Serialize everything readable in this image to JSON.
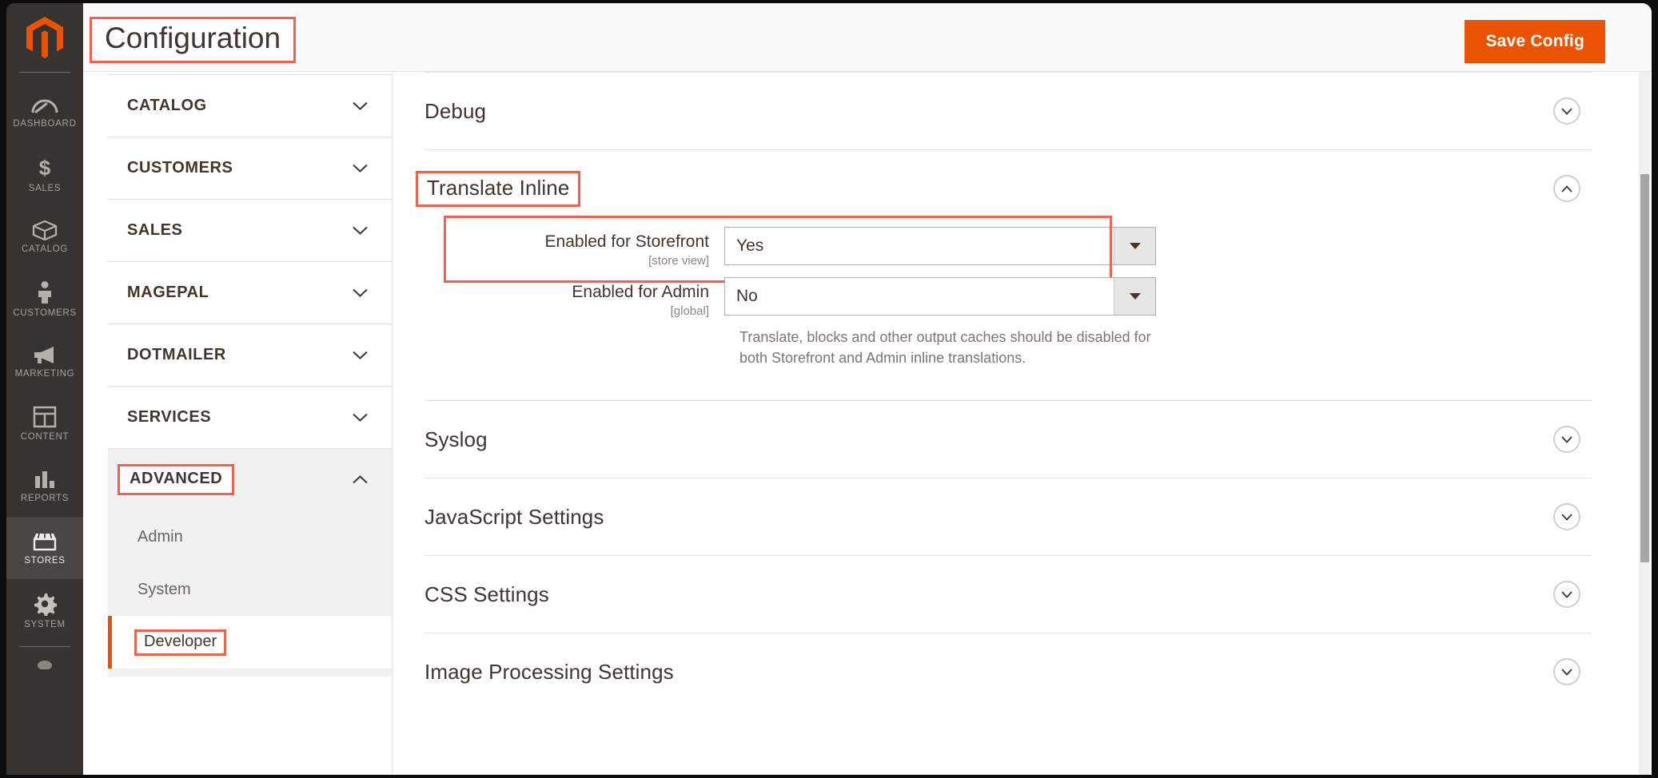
{
  "admin_sidebar": {
    "logo_name": "magento-logo",
    "items": [
      {
        "label": "DASHBOARD",
        "icon": "dashboard-gauge-icon",
        "active": false
      },
      {
        "label": "SALES",
        "icon": "dollar-sign-icon",
        "active": false
      },
      {
        "label": "CATALOG",
        "icon": "box-icon",
        "active": false
      },
      {
        "label": "CUSTOMERS",
        "icon": "person-icon",
        "active": false
      },
      {
        "label": "MARKETING",
        "icon": "megaphone-icon",
        "active": false
      },
      {
        "label": "CONTENT",
        "icon": "layout-page-icon",
        "active": false
      },
      {
        "label": "REPORTS",
        "icon": "bar-chart-icon",
        "active": false
      },
      {
        "label": "STORES",
        "icon": "store-awning-icon",
        "active": true
      },
      {
        "label": "SYSTEM",
        "icon": "gear-icon",
        "active": false
      }
    ]
  },
  "header": {
    "title": "Configuration",
    "save_label": "Save Config"
  },
  "config_nav": {
    "groups": [
      {
        "label": "CATALOG",
        "expanded": false
      },
      {
        "label": "CUSTOMERS",
        "expanded": false
      },
      {
        "label": "SALES",
        "expanded": false
      },
      {
        "label": "MAGEPAL",
        "expanded": false
      },
      {
        "label": "DOTMAILER",
        "expanded": false
      },
      {
        "label": "SERVICES",
        "expanded": false
      },
      {
        "label": "ADVANCED",
        "expanded": true
      }
    ],
    "advanced_children": [
      {
        "label": "Admin",
        "active": false
      },
      {
        "label": "System",
        "active": false
      },
      {
        "label": "Developer",
        "active": true
      }
    ]
  },
  "settings": {
    "sections": [
      {
        "title": "Debug",
        "expanded": false
      },
      {
        "title": "Translate Inline",
        "expanded": true
      },
      {
        "title": "Syslog",
        "expanded": false
      },
      {
        "title": "JavaScript Settings",
        "expanded": false
      },
      {
        "title": "CSS Settings",
        "expanded": false
      },
      {
        "title": "Image Processing Settings",
        "expanded": false
      }
    ],
    "translate_inline": {
      "storefront": {
        "label": "Enabled for Storefront",
        "scope": "[store view]",
        "value": "Yes",
        "options": [
          "Yes",
          "No"
        ]
      },
      "admin": {
        "label": "Enabled for Admin",
        "scope": "[global]",
        "value": "No",
        "options": [
          "Yes",
          "No"
        ],
        "note": "Translate, blocks and other output caches should be disabled for both Storefront and Admin inline translations."
      }
    }
  },
  "colors": {
    "brand_orange": "#eb5202",
    "annotation_red": "#f4604e",
    "sidebar_dark": "#373330",
    "text_dark": "#41362f"
  }
}
